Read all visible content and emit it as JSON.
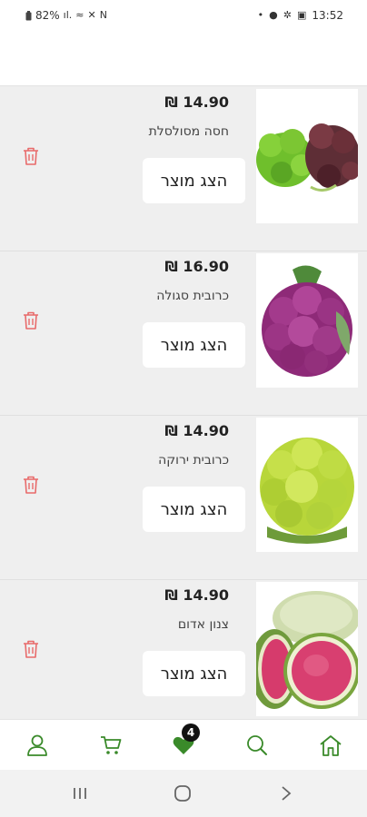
{
  "status_bar": {
    "battery": "82%",
    "time": "13:52"
  },
  "products": [
    {
      "price": "14.90 ₪",
      "name": "חסה מסולסלת",
      "button_label": "הצג מוצר",
      "image": "curly-lettuce"
    },
    {
      "price": "16.90 ₪",
      "name": "כרובית סגולה",
      "button_label": "הצג מוצר",
      "image": "purple-cauliflower"
    },
    {
      "price": "14.90 ₪",
      "name": "כרובית ירוקה",
      "button_label": "הצג מוצר",
      "image": "green-cauliflower"
    },
    {
      "price": "14.90 ₪",
      "name": "צנון אדום",
      "button_label": "הצג מוצר",
      "image": "red-radish"
    }
  ],
  "bottom_nav": {
    "favorites_badge": "4",
    "items": [
      "profile-icon",
      "cart-icon",
      "favorites-heart-icon",
      "search-icon",
      "home-icon"
    ]
  },
  "colors": {
    "accent_green": "#3a8a2a",
    "trash_red": "#e86a6a",
    "list_bg": "#efefef"
  }
}
